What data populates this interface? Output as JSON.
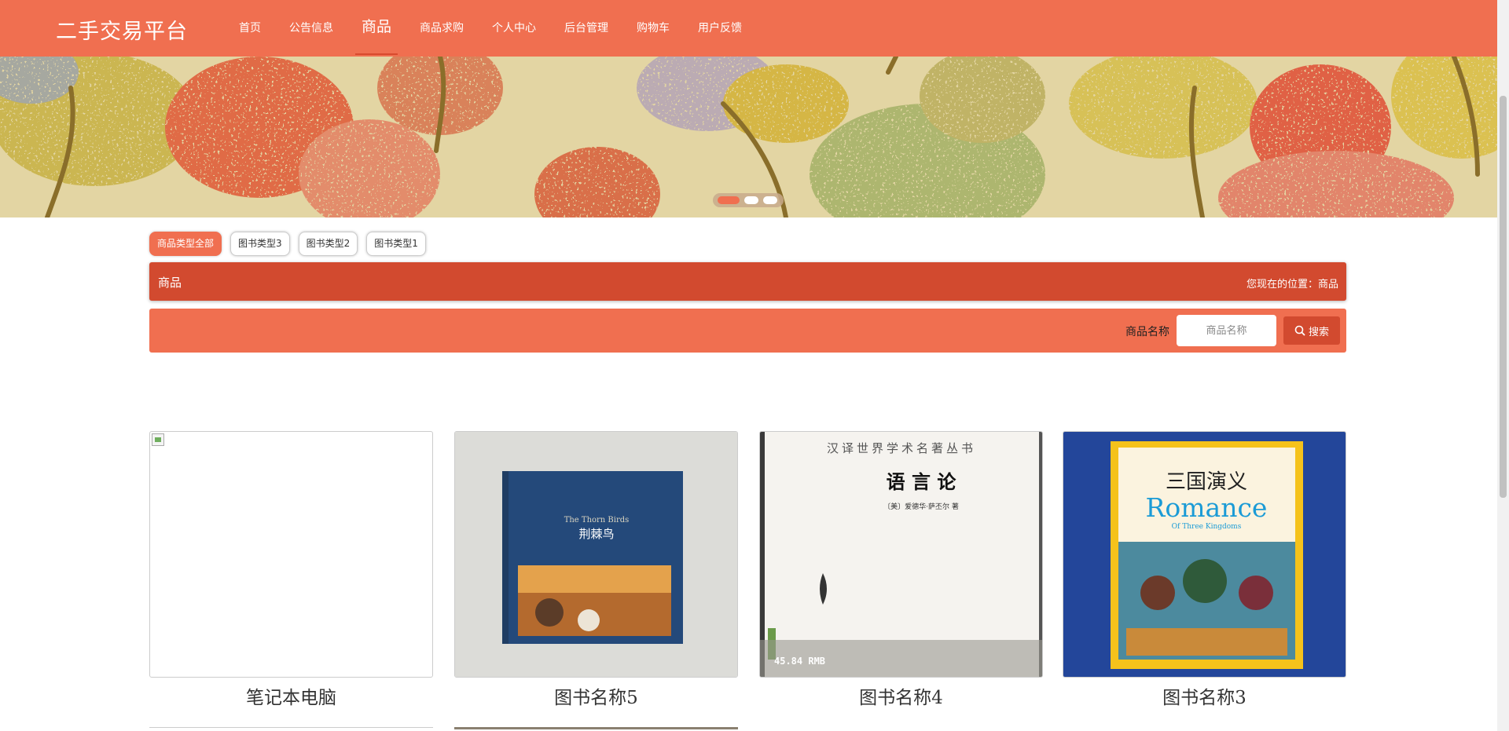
{
  "site": {
    "logo": "二手交易平台"
  },
  "nav": {
    "items": [
      {
        "label": "首页"
      },
      {
        "label": "公告信息"
      },
      {
        "label": "商品"
      },
      {
        "label": "商品求购"
      },
      {
        "label": "个人中心"
      },
      {
        "label": "后台管理"
      },
      {
        "label": "购物车"
      },
      {
        "label": "用户反馈"
      }
    ],
    "active_index": 2
  },
  "banner": {
    "slides": 3,
    "active_slide": 1
  },
  "categories": {
    "tags": [
      {
        "label": "商品类型全部"
      },
      {
        "label": "图书类型3"
      },
      {
        "label": "图书类型2"
      },
      {
        "label": "图书类型1"
      }
    ],
    "active_index": 0
  },
  "titlebar": {
    "title": "商品",
    "location": "您现在的位置：商品"
  },
  "search": {
    "label": "商品名称",
    "placeholder": "商品名称",
    "button_label": "搜索"
  },
  "products": [
    {
      "name": "笔记本电脑"
    },
    {
      "name": "图书名称5",
      "cover_title": "荆棘鸟",
      "cover_subtitle": "The Thorn Birds"
    },
    {
      "name": "图书名称4",
      "cover_series": "汉译世界学术名著丛书",
      "cover_title": "语 言 论",
      "cover_author": "〔美〕爱德华·萨丕尔 著",
      "price_stamp": "45.84 RMB"
    },
    {
      "name": "图书名称3",
      "cover_title": "三国演义",
      "cover_subtitle": "Romance",
      "cover_subtitle2": "Of Three Kingdoms"
    }
  ],
  "colors": {
    "primary": "#f06f50",
    "dark": "#d24a2f"
  }
}
